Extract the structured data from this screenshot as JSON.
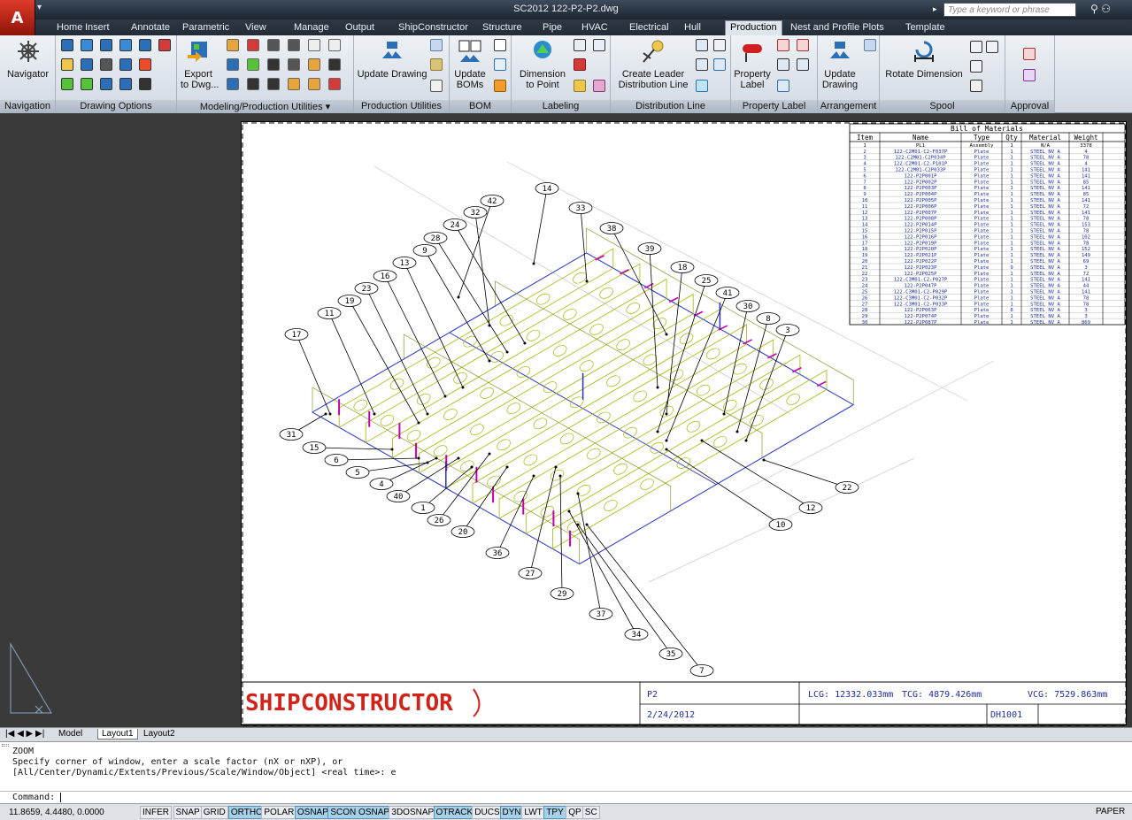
{
  "app": {
    "title": "SC2012   122-P2-P2.dwg",
    "logo_letter": "A",
    "search_placeholder": "Type a keyword or phrase"
  },
  "tabs": [
    "Home",
    "Insert",
    "Annotate",
    "Parametric",
    "View",
    "Manage",
    "Output",
    "ShipConstructor",
    "Structure",
    "Pipe",
    "HVAC",
    "Electrical",
    "Hull",
    "Production",
    "Nest and Profile Plots",
    "Template"
  ],
  "active_tab": "Production",
  "ribbon": {
    "navigator_label": "Navigator",
    "panels": [
      "Navigation",
      "Drawing Options",
      "Modeling/Production Utilities ▾",
      "Production Utilities",
      "BOM",
      "Labeling",
      "Distribution Line",
      "Property Label",
      "Arrangement",
      "Spool",
      "Approval"
    ],
    "buttons": {
      "export": "Export\nto Dwg...",
      "update_drawing": "Update Drawing",
      "update_boms": "Update\nBOMs",
      "dimension_to_point": "Dimension\nto Point",
      "create_leader": "Create Leader\nDistribution Line",
      "property_label": "Property\nLabel",
      "update_drawing_arr": "Update\nDrawing",
      "rotate_dimension": "Rotate Dimension"
    }
  },
  "bom": {
    "title": "Bill of Materials",
    "headers": [
      "Item",
      "Name",
      "Type",
      "Qty",
      "Material",
      "Weight"
    ],
    "rows": [
      [
        "1",
        "PL1",
        "Assembly",
        "1",
        "N/A",
        "3378"
      ],
      [
        "2",
        "122-C2M01-C2-F037P",
        "Plate",
        "1",
        "STEEL NV A",
        "4"
      ],
      [
        "3",
        "122-C2M01-C2P034P",
        "Plate",
        "1",
        "STEEL NV A",
        "78"
      ],
      [
        "4",
        "122-C2M01-C2-P101P",
        "Plate",
        "1",
        "STEEL NV A",
        "4"
      ],
      [
        "5",
        "122-C2M01-C2P033P",
        "Plate",
        "1",
        "STEEL NV A",
        "141"
      ],
      [
        "6",
        "122-P2P001P",
        "Plate",
        "1",
        "STEEL NV A",
        "141"
      ],
      [
        "7",
        "122-P2P002P",
        "Plate",
        "1",
        "STEEL NV A",
        "85"
      ],
      [
        "8",
        "122-P2P003P",
        "Plate",
        "1",
        "STEEL NV A",
        "141"
      ],
      [
        "9",
        "122-P2P004P",
        "Plate",
        "1",
        "STEEL NV A",
        "85"
      ],
      [
        "10",
        "122-P2P005P",
        "Plate",
        "1",
        "STEEL NV A",
        "141"
      ],
      [
        "11",
        "122-P2P006P",
        "Plate",
        "1",
        "STEEL NV A",
        "72"
      ],
      [
        "12",
        "122-P2P007P",
        "Plate",
        "1",
        "STEEL NV A",
        "141"
      ],
      [
        "13",
        "122-P2P008P",
        "Plate",
        "1",
        "STEEL NV A",
        "78"
      ],
      [
        "14",
        "122-P2P014P",
        "Plate",
        "1",
        "STEEL NV A",
        "153"
      ],
      [
        "15",
        "122-P2P015P",
        "Plate",
        "1",
        "STEEL NV A",
        "78"
      ],
      [
        "16",
        "122-P2P016P",
        "Plate",
        "1",
        "STEEL NV A",
        "102"
      ],
      [
        "17",
        "122-P2P019P",
        "Plate",
        "1",
        "STEEL NV A",
        "78"
      ],
      [
        "18",
        "122-P2P020P",
        "Plate",
        "1",
        "STEEL NV A",
        "152"
      ],
      [
        "19",
        "122-P2P021P",
        "Plate",
        "1",
        "STEEL NV A",
        "149"
      ],
      [
        "20",
        "122-P2P022P",
        "Plate",
        "1",
        "STEEL NV A",
        "69"
      ],
      [
        "21",
        "122-P2P023P",
        "Plate",
        "9",
        "STEEL NV A",
        "3"
      ],
      [
        "22",
        "122-P2P025P",
        "Plate",
        "1",
        "STEEL NV A",
        "72"
      ],
      [
        "23",
        "122-C3M01-C2-P027P",
        "Plate",
        "1",
        "STEEL NV A",
        "141"
      ],
      [
        "24",
        "122-P2P047P",
        "Plate",
        "1",
        "STEEL NV A",
        "44"
      ],
      [
        "25",
        "122-C3M01-C2-P029P",
        "Plate",
        "1",
        "STEEL NV A",
        "141"
      ],
      [
        "26",
        "122-C3M01-C2-P032P",
        "Plate",
        "1",
        "STEEL NV A",
        "78"
      ],
      [
        "27",
        "122-C3M01-C2-P033P",
        "Plate",
        "1",
        "STEEL NV A",
        "78"
      ],
      [
        "28",
        "122-P2P063P",
        "Plate",
        "8",
        "STEEL NV A",
        "3"
      ],
      [
        "29",
        "122-P2P074P",
        "Plate",
        "1",
        "STEEL NV A",
        "3"
      ],
      [
        "30",
        "122-P2P087P",
        "Plate",
        "1",
        "STEEL NV A",
        "869"
      ]
    ]
  },
  "title_block": {
    "logo": "SHIPCONSTRUCTOR",
    "drawing": "P2",
    "date": "2/24/2012",
    "lcg": "LCG: 12332.033mm",
    "tcg": "TCG: 4879.426mm",
    "vcg": "VCG: 7529.863mm",
    "code": "DH1001"
  },
  "balloons": [
    "14",
    "42",
    "33",
    "32",
    "24",
    "38",
    "28",
    "39",
    "9",
    "13",
    "16",
    "18",
    "25",
    "23",
    "41",
    "19",
    "30",
    "11",
    "8",
    "17",
    "3",
    "31",
    "15",
    "6",
    "5",
    "4",
    "40",
    "1",
    "26",
    "20",
    "36",
    "27",
    "29",
    "37",
    "34",
    "35",
    "7",
    "22",
    "12",
    "10"
  ],
  "layout_tabs": [
    "Model",
    "Layout1",
    "Layout2"
  ],
  "active_layout": "Layout1",
  "command": {
    "history": [
      "ZOOM",
      "Specify corner of window, enter a scale factor (nX or nXP), or",
      "[All/Center/Dynamic/Extents/Previous/Scale/Window/Object] <real time>: e"
    ],
    "prompt": "Command:"
  },
  "status": {
    "coords": "11.8659, 4.4480, 0.0000",
    "toggles": [
      {
        "label": "INFER",
        "on": false
      },
      {
        "label": "SNAP",
        "on": false
      },
      {
        "label": "GRID",
        "on": false
      },
      {
        "label": "ORTHO",
        "on": true
      },
      {
        "label": "POLAR",
        "on": false
      },
      {
        "label": "OSNAP",
        "on": true
      },
      {
        "label": "SCON OSNAP",
        "on": true
      },
      {
        "label": "3DOSNAP",
        "on": false
      },
      {
        "label": "OTRACK",
        "on": true
      },
      {
        "label": "DUCS",
        "on": false
      },
      {
        "label": "DYN",
        "on": true
      },
      {
        "label": "LWT",
        "on": false
      },
      {
        "label": "TPY",
        "on": true
      },
      {
        "label": "QP",
        "on": false
      },
      {
        "label": "SC",
        "on": false
      }
    ],
    "paper": "PAPER"
  }
}
